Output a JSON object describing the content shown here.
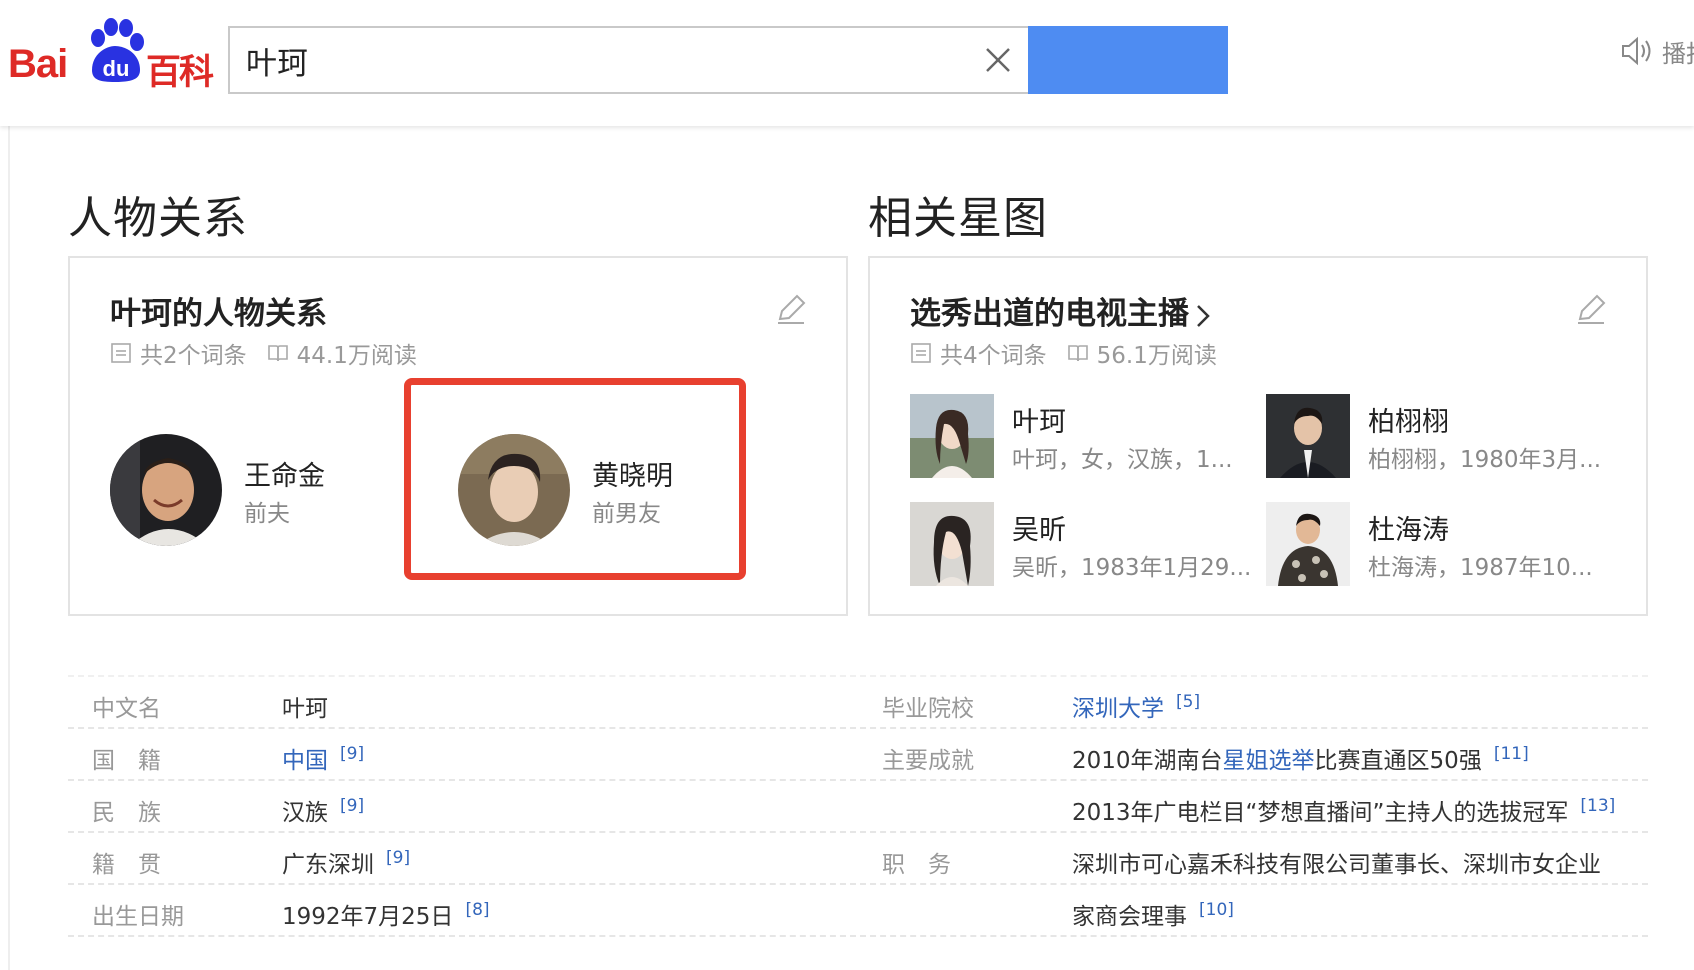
{
  "header": {
    "logo_bai": "Bai",
    "logo_du": "du",
    "logo_baike": "百科",
    "search_value": "叶珂",
    "speaker_label": "播报"
  },
  "sections": {
    "relations_title": "人物关系",
    "stars_title": "相关星图"
  },
  "relations_card": {
    "title": "叶珂的人物关系",
    "entry_count": "共2个词条",
    "reads": "44.1万阅读",
    "people": [
      {
        "name": "王命金",
        "relation": "前夫"
      },
      {
        "name": "黄晓明",
        "relation": "前男友"
      }
    ]
  },
  "stars_card": {
    "title": "选秀出道的电视主播",
    "entry_count": "共4个词条",
    "reads": "56.1万阅读",
    "stars": [
      {
        "name": "叶珂",
        "desc": "叶珂，女，汉族，1..."
      },
      {
        "name": "柏栩栩",
        "desc": "柏栩栩，1980年3月..."
      },
      {
        "name": "吴昕",
        "desc": "吴昕，1983年1月29..."
      },
      {
        "name": "杜海涛",
        "desc": "杜海涛，1987年10..."
      }
    ]
  },
  "info": {
    "left": [
      {
        "label": "中文名",
        "value": "叶珂",
        "ref": ""
      },
      {
        "label": "国　籍",
        "value": "中国",
        "ref": "[9]"
      },
      {
        "label": "民　族",
        "value": "汉族",
        "ref": "[9]"
      },
      {
        "label": "籍　贯",
        "value": "广东深圳",
        "ref": "[9]"
      },
      {
        "label": "出生日期",
        "value": "1992年7月25日",
        "ref": "[8]"
      }
    ],
    "right": [
      {
        "label": "毕业院校",
        "value": "深圳大学",
        "ref": "[5]"
      },
      {
        "label": "主要成就",
        "value_pre": "2010年湖南台",
        "value_link": "星姐选举",
        "value_post": "比赛直通区50强",
        "ref": "[11]"
      },
      {
        "label": "",
        "value": "2013年广电栏目“梦想直播间”主持人的选拔冠军",
        "ref": "[13]"
      },
      {
        "label": "职　务",
        "value": "深圳市可心嘉禾科技有限公司董事长、深圳市女企业",
        "ref": ""
      },
      {
        "label": "",
        "value": "家商会理事",
        "ref": "[10]"
      }
    ]
  },
  "colors": {
    "brand_red": "#de2a26",
    "brand_blue": "#2932e1",
    "search_button": "#4e8cf2",
    "link": "#3366bb",
    "highlight": "#e8402f"
  }
}
